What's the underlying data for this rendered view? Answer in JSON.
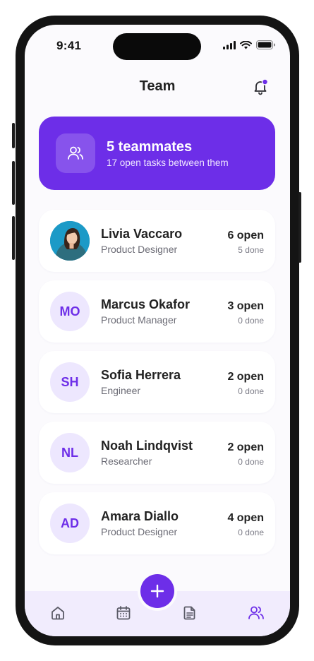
{
  "status": {
    "time": "9:41"
  },
  "header": {
    "title": "Team"
  },
  "summary": {
    "title": "5 teammates",
    "subtitle": "17 open tasks between them"
  },
  "members": [
    {
      "name": "Livia Vaccaro",
      "role": "Product Designer",
      "initials": "",
      "open": "6 open",
      "done": "5 done",
      "has_photo": true
    },
    {
      "name": "Marcus Okafor",
      "role": "Product Manager",
      "initials": "MO",
      "open": "3 open",
      "done": "0 done"
    },
    {
      "name": "Sofia Herrera",
      "role": "Engineer",
      "initials": "SH",
      "open": "2 open",
      "done": "0 done"
    },
    {
      "name": "Noah Lindqvist",
      "role": "Researcher",
      "initials": "NL",
      "open": "2 open",
      "done": "0 done"
    },
    {
      "name": "Amara Diallo",
      "role": "Product Designer",
      "initials": "AD",
      "open": "4 open",
      "done": "0 done"
    }
  ],
  "tabs": [
    {
      "icon": "home-icon"
    },
    {
      "icon": "calendar-icon"
    },
    {
      "icon": "document-icon"
    },
    {
      "icon": "team-icon",
      "active": true
    }
  ],
  "colors": {
    "accent": "#6d2ee8",
    "accent_soft": "#ede7fe",
    "tabbar": "#f1ecfd"
  }
}
